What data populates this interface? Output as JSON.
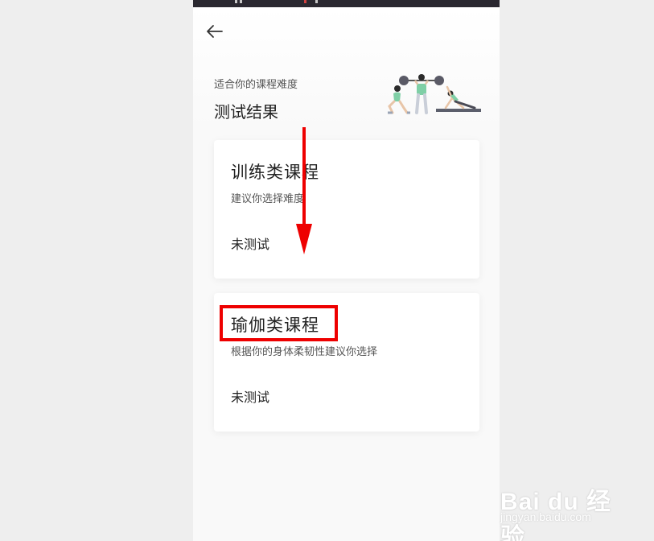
{
  "header": {
    "subtitle": "适合你的课程难度",
    "title": "测试结果"
  },
  "cards": [
    {
      "title": "训练类课程",
      "description": "建议你选择难度",
      "status": "未测试",
      "accent_color": "#e0f2ea"
    },
    {
      "title": "瑜伽类课程",
      "description": "根据你的身体柔韧性建议你选择",
      "status": "未测试",
      "accent_color": "#e6ebf6"
    }
  ],
  "annotations": {
    "arrow_color": "#ee0000",
    "box_color": "#ee0000"
  },
  "watermark": {
    "text": "Bai du 经验",
    "url": "jingyan.baidu.com"
  },
  "icons": {
    "back": "back-arrow-icon",
    "illustration": "fitness-illustration-icon"
  }
}
